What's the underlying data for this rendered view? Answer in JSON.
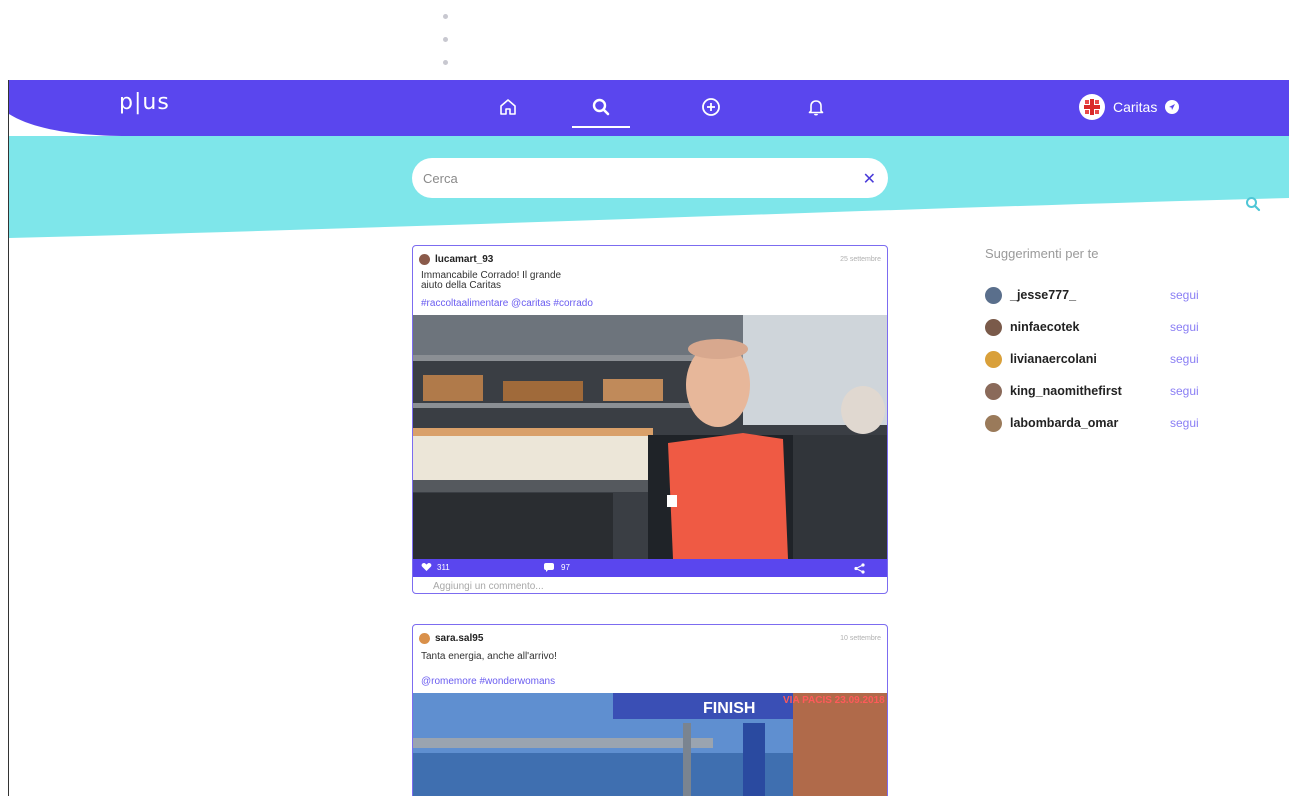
{
  "app": {
    "logo": "p|us"
  },
  "nav": {
    "home_label": "home",
    "search_label": "search",
    "add_label": "add",
    "notifications_label": "notifications"
  },
  "user": {
    "name": "Caritas"
  },
  "search": {
    "placeholder": "Cerca",
    "value": ""
  },
  "posts": [
    {
      "username": "lucamart_93",
      "date": "25 settembre",
      "caption": "Immancabile Corrado! Il grande\naiuto della Caritas",
      "tags": "#raccoltaalimentare @caritas #corrado",
      "likes": "311",
      "comments": "97",
      "comment_placeholder": "Aggiungi un commento..."
    },
    {
      "username": "sara.sal95",
      "date": "10 settembre",
      "caption": "Tanta energia, anche all'arrivo!",
      "tags": "@romemore #wonderwomans",
      "banner_text": "FINISH",
      "banner_subtext": "VIA PACIS 23.09.2018"
    }
  ],
  "suggestions": {
    "title": "Suggerimenti per te",
    "follow_label": "segui",
    "users": [
      {
        "name": "_jesse777_",
        "color": "#5a6f8c"
      },
      {
        "name": "ninfaecotek",
        "color": "#7a5a4a"
      },
      {
        "name": "livianaercolani",
        "color": "#d9a03a"
      },
      {
        "name": "king_naomithefirst",
        "color": "#8a6a5a"
      },
      {
        "name": "labombarda_omar",
        "color": "#9a7a5a"
      }
    ]
  },
  "colors": {
    "primary": "#5a46ee",
    "cyan": "#7ee6ea",
    "accent": "#6a5cf0"
  }
}
